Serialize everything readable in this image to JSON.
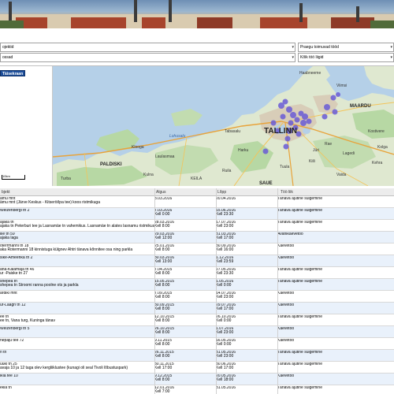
{
  "filters": {
    "left_top": "ojektid",
    "left_bottom": "ossad",
    "right_top": "Praegu toimuvad tööd",
    "right_bottom": "Kõik töö liigid"
  },
  "map": {
    "fullscreen_label": "Täisekraan",
    "scale_label": "10km",
    "labels": {
      "tallinn": "TALLINN",
      "paldiski": "PALDISKI",
      "maardu": "MAARDU",
      "saue": "SAUE",
      "keila": "KEILA",
      "harku": "Harku",
      "viimsi": "Viimsi",
      "haabneeme": "Haabneeme",
      "kostivere": "Kostivere",
      "aegviidu": "Kiili",
      "vaida": "Vaida",
      "kulna": "Kulna",
      "turba": "Turba",
      "laulasmaa": "Laulasmaa",
      "klooga": "Klooga",
      "tabasalu": "Tabasalu",
      "ruila": "Ruila",
      "kehra": "Kehra",
      "rae": "Rae",
      "kolga": "Kolga",
      "juri": "Jüri",
      "lagedi": "Lagedi",
      "loksa": "Lohusalu",
      "tuula": "Tuula"
    }
  },
  "table": {
    "headers": [
      "bjekt",
      "Algus",
      "Lõpp",
      "Töö liik"
    ],
    "rows": [
      {
        "obj1": "ämu mnt",
        "obj2": "ämu mnt (Järve Keskus - Kitseröõpa tee) koos ristmikuga",
        "start": "3.03.2016",
        "start_time": "",
        "end": "20.04.2016",
        "end_time": "",
        "type": "Tänava ajutine sulgemine"
      },
      {
        "obj1": "Weizenbergi tn 2",
        "obj2": "",
        "start": "7.03.2016",
        "start_time": "Kell 0:00",
        "end": "15.06.2016",
        "end_time": "Kell 23:30",
        "type": "Tänava ajutine sulgemine"
      },
      {
        "obj1": "ajaka tn",
        "obj2": "ajaka tn Peterburi tee ja Lasnamäe tn vahemikus. Lasnamäe tn alates lasnamu ristmikust kuni Majaka tänava risti",
        "start": "28.03.2016",
        "start_time": "Kell 8:00",
        "end": "17.07.2016",
        "end_time": "Kell 23:00",
        "type": "Tänava ajutine sulgemine"
      },
      {
        "obj1": "ille tn 59",
        "obj2": "ajaka laga",
        "start": "29.03.2016",
        "start_time": "Kell 12:00",
        "end": "31.03.2016",
        "end_time": "Kell 17:00",
        "type": "Avariikaevetöö"
      },
      {
        "obj1": "oterrmanni tn 18",
        "obj2": "aka Rotermanni 18 kinnistuga külgnev Ahtri tänava kõnnitee osa ning parkla",
        "start": "25.01.2016",
        "start_time": "Kell 8:00",
        "end": "30.09.2016",
        "end_time": "Kell 16:00",
        "type": "Kaevetöö"
      },
      {
        "obj1": "sike-Ameerika tn 2",
        "obj2": "",
        "start": "30.03.2016",
        "start_time": "Kell 13:00",
        "end": "1.12.2016",
        "end_time": "Kell 23:59",
        "type": "Kaevetöö"
      },
      {
        "obj1": "ana-Kalamaja tn 46",
        "obj2": "ur -Paiske tn 27",
        "start": "7.04.2015",
        "start_time": "Kell 8:00",
        "end": "27.05.2016",
        "end_time": "Kell 23:30",
        "type": "Tänava ajutine sulgemine"
      },
      {
        "obj1": "shepea tn",
        "obj2": "shepea tn Stroomi ranna poolne ots ja parkla",
        "start": "15.05.2015",
        "start_time": "Kell 8:00",
        "end": "1.05.2016",
        "end_time": "Kell 0:00",
        "type": "Tänava ajutine sulgemine"
      },
      {
        "obj1": "ärdiki mnt",
        "obj2": "",
        "start": "7.09.2015",
        "start_time": "Kell 8:00",
        "end": "14.07.2016",
        "end_time": "Kell 23:00",
        "type": "Kaevetöö"
      },
      {
        "obj1": "ur-Laagri tn 12",
        "obj2": "",
        "start": "30.09.2015",
        "start_time": "Kell 8:00",
        "end": "29.07.2016",
        "end_time": "Kell 17:00",
        "type": "Kaevetöö"
      },
      {
        "obj1": "ee tn",
        "obj2": "ee tn, Vana turg, Kuninga tänav",
        "start": "12.10.2015",
        "start_time": "Kell 8:00",
        "end": "26.10.2016",
        "end_time": "Kell 0:00",
        "type": "Tänava ajutine sulgemine"
      },
      {
        "obj1": "Weizenbergi tn 5",
        "obj2": "",
        "start": "26.10.2015",
        "start_time": "Kell 8:00",
        "end": "1.07.2016",
        "end_time": "Kell 23:00",
        "type": "Kaevetöö"
      },
      {
        "obj1": "hepaju tee 72",
        "obj2": "",
        "start": "9.11.2015",
        "start_time": "Kell 8:00",
        "end": "16.05.2016",
        "end_time": "Kell 0:00",
        "type": "Kaevetöö"
      },
      {
        "obj1": "ri tn",
        "obj2": "",
        "start": "26.11.2015",
        "start_time": "Kell 8:00",
        "end": "31.05.2016",
        "end_time": "Kell 23:00",
        "type": "Tänava ajutine sulgemine"
      },
      {
        "obj1": "uuki tn 25",
        "obj2": "avaja 10 ja 12 taga olev kergliiklustee (kunagi oli seal Tivoli lõbustuspark)",
        "start": "30.11.2015",
        "start_time": "Kell 17:00",
        "end": "30.06.2016",
        "end_time": "Kell 17:00",
        "type": "Tänava ajutine sulgemine"
      },
      {
        "obj1": "ikla tee 10",
        "obj2": "",
        "start": "9.12.2015",
        "start_time": "Kell 8:00",
        "end": "20.05.2016",
        "end_time": "Kell 18:00",
        "type": "Kaevetöö"
      },
      {
        "obj1": "ekla tn",
        "obj2": "",
        "start": "12.01.2016",
        "start_time": "Kell 7:00",
        "end": "31.05.2016",
        "end_time": "",
        "type": "Tänava ajutine sulgemine"
      }
    ]
  }
}
